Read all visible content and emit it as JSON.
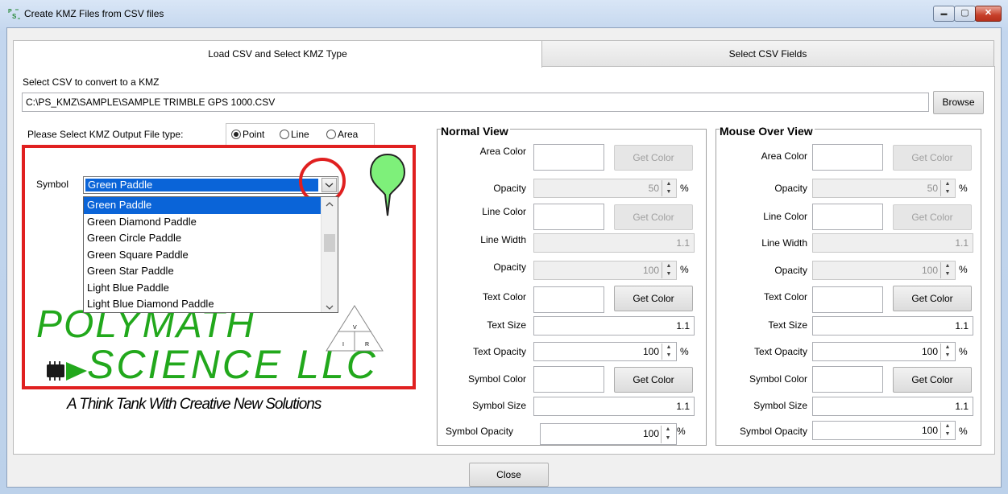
{
  "window": {
    "title": "Create KMZ Files from CSV files",
    "minimize_glyph": "▬",
    "maximize_glyph": "▢",
    "close_glyph": "✕"
  },
  "tabs": [
    {
      "label": "Load CSV and Select KMZ Type",
      "active": true
    },
    {
      "label": "Select CSV Fields",
      "active": false
    }
  ],
  "csv": {
    "prompt": "Select CSV to convert to a KMZ",
    "path": "C:\\PS_KMZ\\SAMPLE\\SAMPLE TRIMBLE GPS 1000.CSV",
    "browse_label": "Browse"
  },
  "output_type": {
    "label": "Please Select KMZ Output File type:",
    "options": [
      "Point",
      "Line",
      "Area"
    ],
    "selected": "Point"
  },
  "symbol": {
    "label": "Symbol",
    "selected": "Green Paddle",
    "items": [
      "Green Paddle",
      "Green Diamond Paddle",
      "Green Circle Paddle",
      "Green Square Paddle",
      "Green Star Paddle",
      "Light Blue Paddle",
      "Light Blue Diamond Paddle"
    ]
  },
  "logo": {
    "line1": "POLYMATH",
    "line2": "SCIENCE LLC",
    "tagline": "A Think Tank With Creative New Solutions",
    "triangle_letters": [
      "V",
      "I",
      "R"
    ]
  },
  "normal_view": {
    "title": "Normal View",
    "area_color": "Area Color",
    "opacity": "Opacity",
    "area_opacity_value": "50",
    "line_color": "Line Color",
    "line_width": "Line Width",
    "line_width_value": "1.1",
    "line_opacity_value": "100",
    "text_color": "Text Color",
    "text_size": "Text Size",
    "text_size_value": "1.1",
    "text_opacity": "Text Opacity",
    "text_opacity_value": "100",
    "symbol_color": "Symbol Color",
    "symbol_size": "Symbol Size",
    "symbol_size_value": "1.1",
    "symbol_opacity": "Symbol Opacity",
    "symbol_opacity_value": "100",
    "get_color": "Get Color",
    "percent": "%"
  },
  "mouse_over_view": {
    "title": "Mouse Over View",
    "area_color": "Area Color",
    "opacity": "Opacity",
    "area_opacity_value": "50",
    "line_color": "Line Color",
    "line_width": "Line Width",
    "line_width_value": "1.1",
    "line_opacity_value": "100",
    "text_color": "Text Color",
    "text_size": "Text Size",
    "text_size_value": "1.1",
    "text_opacity": "Text Opacity",
    "text_opacity_value": "100",
    "symbol_color": "Symbol Color",
    "symbol_size": "Symbol Size",
    "symbol_size_value": "1.1",
    "symbol_opacity": "Symbol Opacity",
    "symbol_opacity_value": "100",
    "get_color": "Get Color",
    "percent": "%"
  },
  "close_label": "Close",
  "colors": {
    "highlight_red": "#e02020",
    "selection_blue": "#0a64d8",
    "logo_green": "#22a81c",
    "pin_green": "#7ef07a"
  }
}
